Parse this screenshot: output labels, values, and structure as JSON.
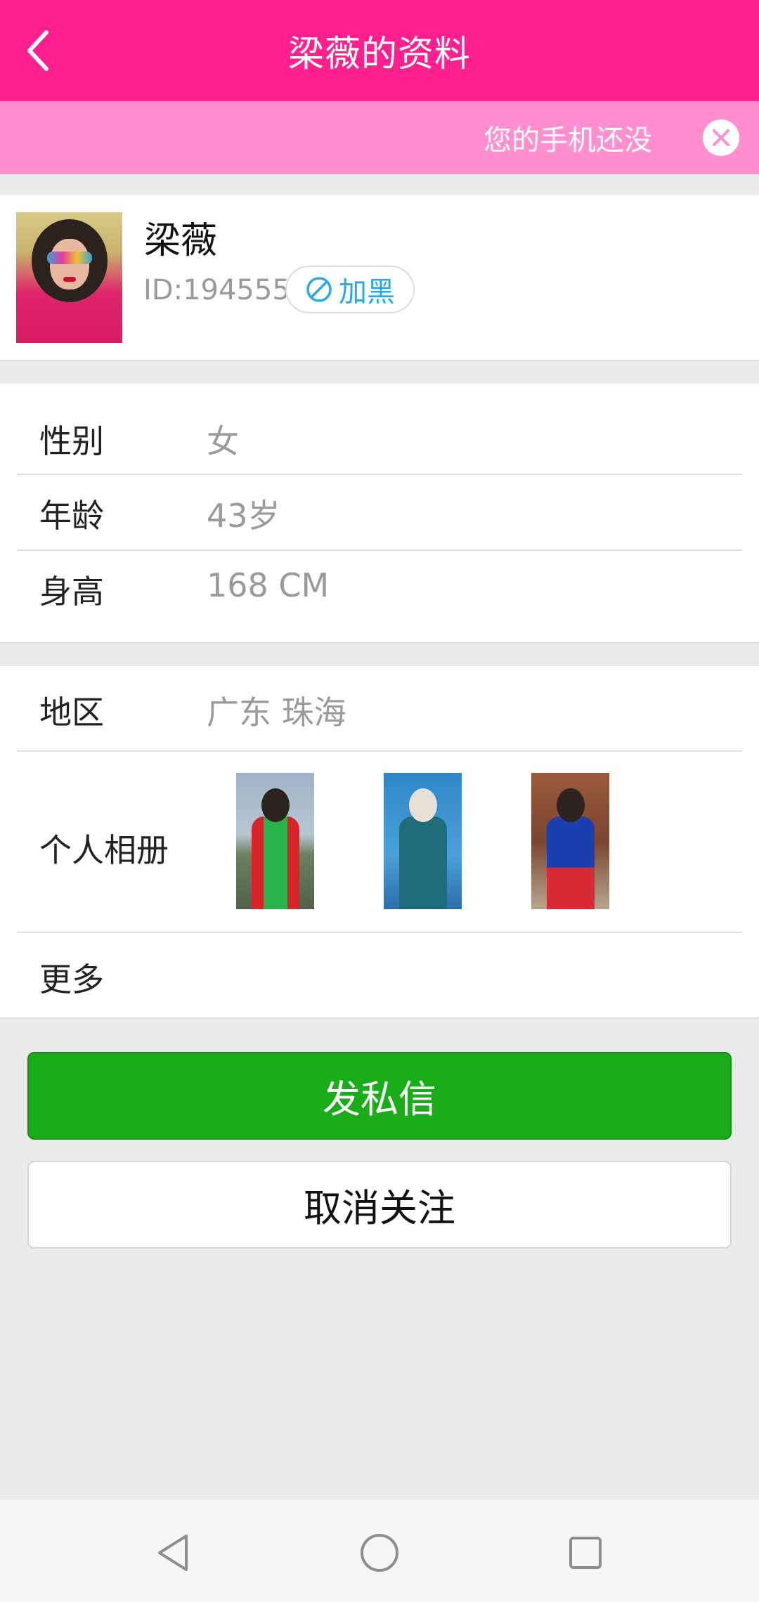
{
  "header": {
    "title": "梁薇的资料",
    "back_icon": "chevron-left-icon",
    "background": "#ff1f8e"
  },
  "notice": {
    "text": "您的手机还没",
    "close_icon": "close-circle-icon",
    "background": "#ff8fcf"
  },
  "profile": {
    "name": "梁薇",
    "id_text": "ID:194555",
    "block_label": "加黑",
    "block_icon": "block-icon"
  },
  "details": [
    {
      "label": "性别",
      "value": "女"
    },
    {
      "label": "年龄",
      "value": "43岁"
    },
    {
      "label": "身高",
      "value": "168 CM"
    }
  ],
  "location": {
    "label": "地区",
    "value": "广东 珠海"
  },
  "album": {
    "label": "个人相册",
    "photo_count": 3
  },
  "more": {
    "label": "更多"
  },
  "actions": {
    "message_label": "发私信",
    "unfollow_label": "取消关注",
    "primary_color": "#1aad19"
  },
  "system_nav": {
    "back_icon": "triangle-back-icon",
    "home_icon": "circle-home-icon",
    "recents_icon": "square-recents-icon"
  }
}
